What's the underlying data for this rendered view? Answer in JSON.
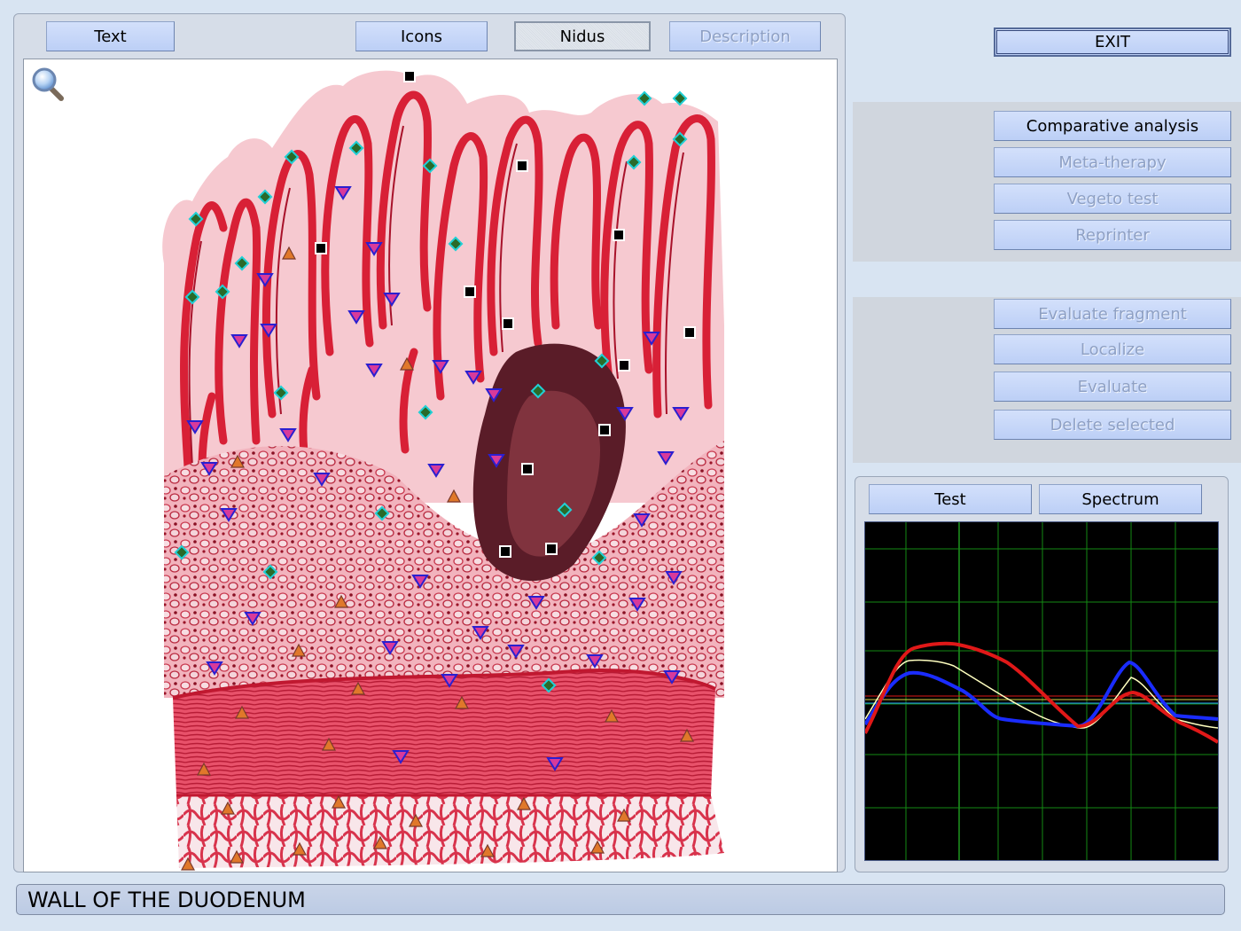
{
  "tabs": {
    "text": "Text",
    "icons": "Icons",
    "nidus": "Nidus",
    "description": "Description"
  },
  "exit_label": "EXIT",
  "actions_group_1": [
    {
      "label": "Comparative analysis",
      "enabled": true
    },
    {
      "label": "Meta-therapy",
      "enabled": false
    },
    {
      "label": "Vegeto test",
      "enabled": false
    },
    {
      "label": "Reprinter",
      "enabled": false
    }
  ],
  "actions_group_2": [
    {
      "label": "Evaluate fragment",
      "enabled": false
    },
    {
      "label": "Localize",
      "enabled": false
    },
    {
      "label": "Evaluate",
      "enabled": false
    },
    {
      "label": "Delete selected",
      "enabled": false
    }
  ],
  "chart_tabs": {
    "test": "Test",
    "spectrum": "Spectrum"
  },
  "status_text": "WALL OF THE DUODENUM",
  "icons": {
    "magnifier": "magnifier-icon"
  },
  "colors": {
    "tissue_red": "#d9283a",
    "marker_cyan": "#21d0d6",
    "marker_blue": "#2a1fd0",
    "marker_orange": "#e0782a",
    "marker_black": "#000000",
    "series_red": "#e01818",
    "series_blue": "#1a2cff",
    "series_yellow": "#ffffc0"
  }
}
